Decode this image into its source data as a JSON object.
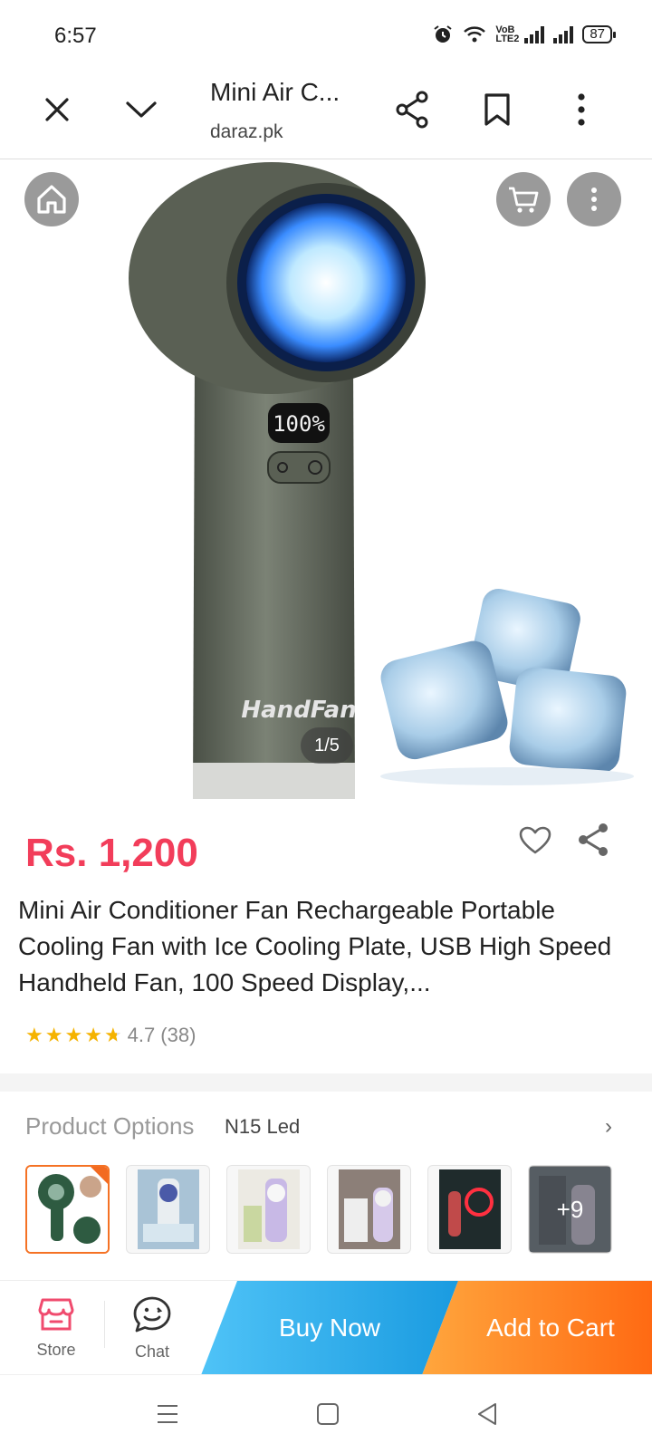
{
  "status": {
    "time": "6:57",
    "battery": "87",
    "network_label": "VoB LTE2"
  },
  "browser": {
    "tab_title": "Mini Air C...",
    "domain": "daraz.pk"
  },
  "gallery": {
    "page_indicator": "1/5",
    "brand_text": "HandFan",
    "display_text": "100%"
  },
  "product": {
    "price": "Rs. 1,200",
    "title": "Mini Air Conditioner Fan Rechargeable Portable Cooling Fan with Ice Cooling Plate, USB High Speed Handheld Fan, 100 Speed Display,...",
    "rating": "4.7",
    "rating_count": "(38)",
    "rating_value": 4.7
  },
  "options": {
    "label": "Product Options",
    "selected": "N15 Led",
    "more_count": "+9"
  },
  "bottom_bar": {
    "store_label": "Store",
    "chat_label": "Chat",
    "buy_now_label": "Buy Now",
    "add_to_cart_label": "Add to Cart"
  },
  "colors": {
    "price": "#f23d5a",
    "accent_orange": "#ff6a13",
    "accent_blue": "#1a9be0",
    "store_icon": "#f04b6e"
  }
}
